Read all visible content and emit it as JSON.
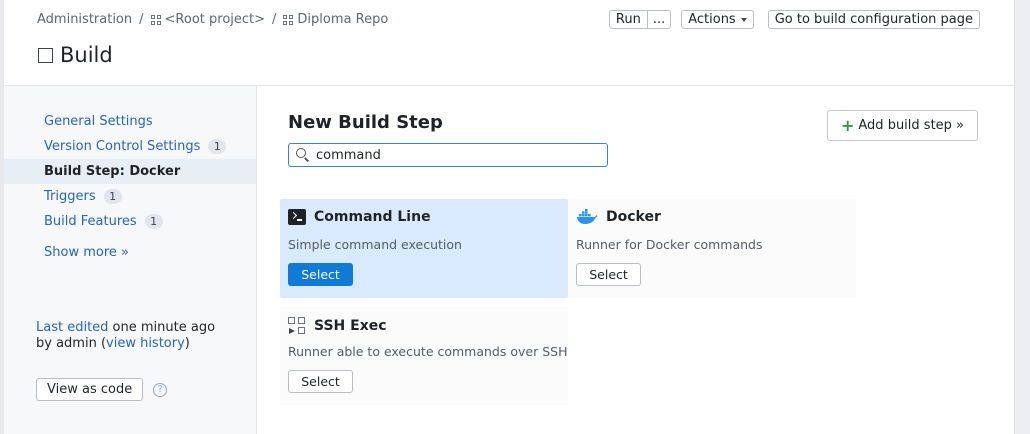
{
  "breadcrumb": {
    "items": [
      "Administration",
      "<Root project>",
      "Diploma Repo"
    ],
    "separator": "/"
  },
  "header": {
    "title": "Build",
    "run_label": "Run",
    "run_more_label": "...",
    "actions_label": "Actions",
    "goto_config_label": "Go to build configuration page"
  },
  "sidebar": {
    "items": [
      {
        "label": "General Settings",
        "count": null
      },
      {
        "label": "Version Control Settings",
        "count": "1"
      },
      {
        "label": "Build Step: Docker",
        "count": null
      },
      {
        "label": "Triggers",
        "count": "1"
      },
      {
        "label": "Build Features",
        "count": "1"
      }
    ],
    "show_more": "Show more »",
    "last_edited_link": "Last edited",
    "last_edited_time": " one minute ago",
    "by_text": "by admin  (",
    "view_history": "view history",
    "close_paren": ")",
    "view_as_code": "View as code",
    "help_glyph": "?"
  },
  "main": {
    "title": "New Build Step",
    "search_value": "command",
    "add_step_label": "Add build step »",
    "runners": [
      {
        "name": "Command Line",
        "description": "Simple command execution",
        "select": "Select",
        "icon": "terminal-icon",
        "highlighted": true
      },
      {
        "name": "Docker",
        "description": "Runner for Docker commands",
        "select": "Select",
        "icon": "docker-icon",
        "highlighted": false
      },
      {
        "name": "SSH Exec",
        "description": "Runner able to execute commands over SSH",
        "select": "Select",
        "icon": "ssh-exec-icon",
        "highlighted": false
      }
    ]
  },
  "colors": {
    "link": "#2564c0",
    "primary": "#0f7ad8",
    "highlight": "#d8eafb",
    "docker": "#2496ed",
    "plus": "#2e9a3c"
  }
}
